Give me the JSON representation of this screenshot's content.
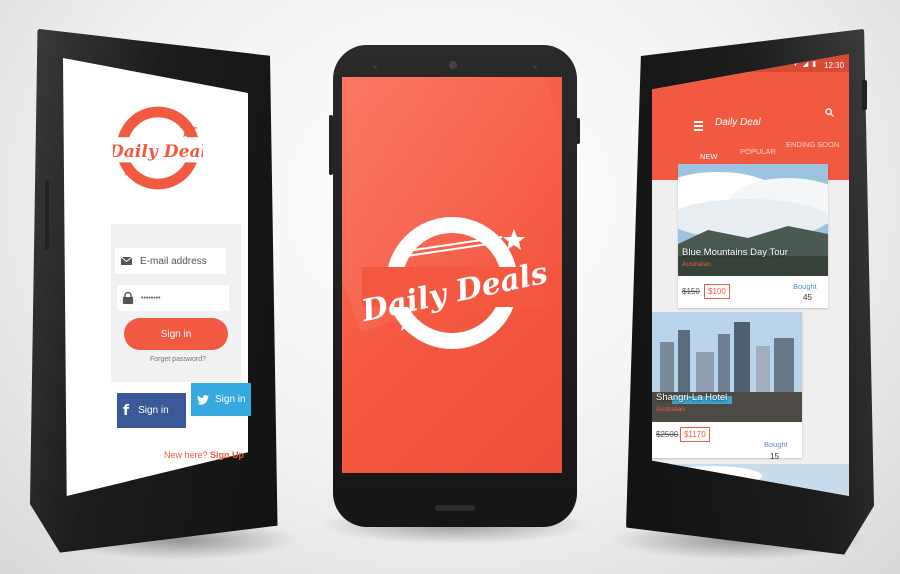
{
  "login_screen": {
    "logo_text": "Daily Deal",
    "email_placeholder": "E-mail address",
    "password_value": "••••••••",
    "signin_label": "Sign in",
    "forget_password": "Forget password?",
    "facebook_label": "Sign in",
    "twitter_label": "Sign in",
    "new_here": "New here?",
    "sign_up": "Sign Up"
  },
  "splash_screen": {
    "logo_text": "Daily Deals"
  },
  "deals_screen": {
    "status_time": "12:30",
    "title": "Daily Deal",
    "tabs": [
      "NEW",
      "POPULAR",
      "ENDING SOON"
    ],
    "active_tab": "NEW",
    "deals": [
      {
        "title": "Blue Mountains Day Tour",
        "location": "Australian",
        "old_price": "$150",
        "new_price": "$100",
        "bought_label": "Bought",
        "bought_count": "45"
      },
      {
        "title": "Shangri-La Hotel",
        "location": "Australian",
        "old_price": "$2500",
        "new_price": "$1170",
        "bought_label": "Bought",
        "bought_count": "15"
      }
    ]
  },
  "colors": {
    "brand": "#f15a41",
    "facebook": "#3b5998",
    "twitter": "#36a9e1"
  }
}
